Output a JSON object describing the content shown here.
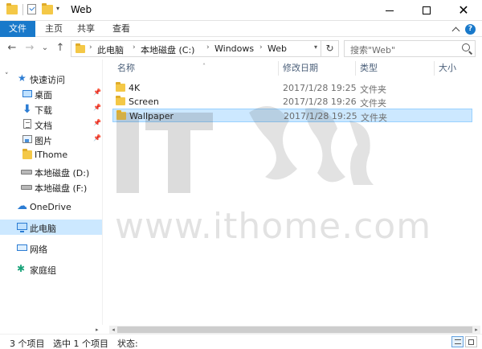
{
  "window": {
    "title": "Web",
    "minimize": "—",
    "maximize": "☐",
    "close": "✕"
  },
  "ribbon": {
    "tabs": [
      "文件",
      "主页",
      "共享",
      "查看"
    ]
  },
  "nav": {
    "back": "←",
    "forward": "→",
    "recent": "⌄",
    "up": "↑",
    "breadcrumbs": [
      "此电脑",
      "本地磁盘 (C:)",
      "Windows",
      "Web"
    ],
    "separator": "›",
    "refresh": "↻",
    "search_placeholder": "搜索\"Web\""
  },
  "sidebar": {
    "quick_access": "快速访问",
    "items": [
      {
        "label": "桌面",
        "icon": "desktop-icon",
        "pinned": true
      },
      {
        "label": "下载",
        "icon": "download-icon",
        "pinned": true
      },
      {
        "label": "文档",
        "icon": "document-icon",
        "pinned": true
      },
      {
        "label": "图片",
        "icon": "picture-icon",
        "pinned": true
      },
      {
        "label": "IThome",
        "icon": "folder-icon",
        "pinned": false
      },
      {
        "label": "本地磁盘 (D:)",
        "icon": "drive-icon",
        "pinned": false
      },
      {
        "label": "本地磁盘 (F:)",
        "icon": "drive-icon",
        "pinned": false
      }
    ],
    "onedrive": "OneDrive",
    "this_pc": "此电脑",
    "network": "网络",
    "homegroup": "家庭组"
  },
  "columns": {
    "name": "名称",
    "date": "修改日期",
    "type": "类型",
    "size": "大小"
  },
  "files": [
    {
      "name": "4K",
      "date": "2017/1/28 19:25",
      "type": "文件夹",
      "selected": false
    },
    {
      "name": "Screen",
      "date": "2017/1/28 19:26",
      "type": "文件夹",
      "selected": false
    },
    {
      "name": "Wallpaper",
      "date": "2017/1/28 19:25",
      "type": "文件夹",
      "selected": true
    }
  ],
  "status": {
    "count": "3 个项目",
    "selected": "选中 1 个项目",
    "state": "状态:"
  },
  "watermark": {
    "text": "www.ithome.com"
  },
  "colors": {
    "accent": "#1979ca",
    "selection": "#cce8ff",
    "folder": "#f4c847"
  }
}
